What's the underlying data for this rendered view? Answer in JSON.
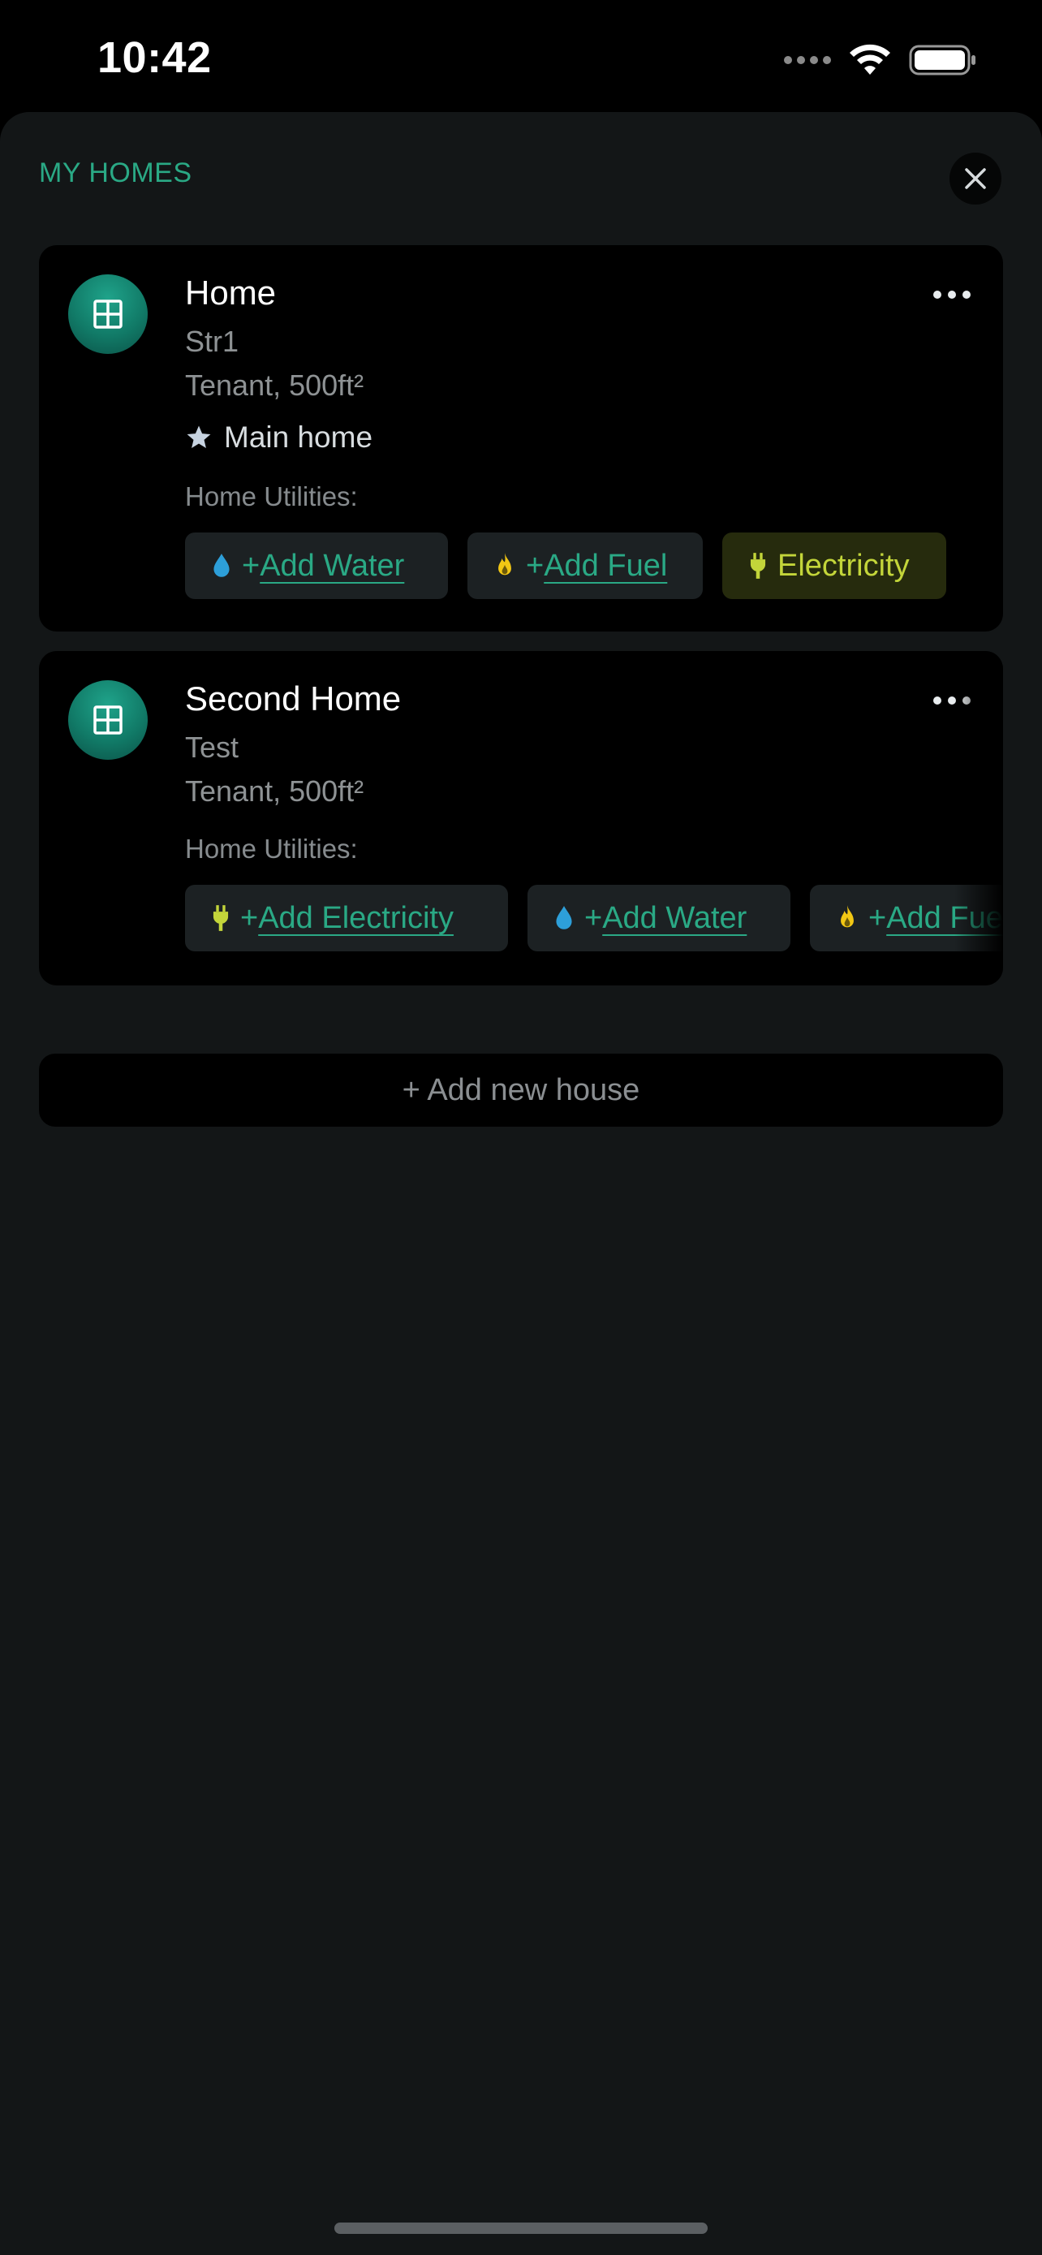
{
  "status": {
    "time": "10:42"
  },
  "sheet": {
    "title": "MY HOMES"
  },
  "homes": [
    {
      "name": "Home",
      "street": "Str1",
      "meta": "Tenant, 500ft²",
      "main_home_label": "Main home",
      "utilities_label": "Home Utilities:",
      "utilities": [
        {
          "icon": "water-drop-icon",
          "plus": "+",
          "label": "Add Water",
          "active": false
        },
        {
          "icon": "flame-icon",
          "plus": "+",
          "label": "Add Fuel",
          "active": false
        },
        {
          "icon": "plug-icon",
          "plus": "",
          "label": "Electricity",
          "active": true
        }
      ]
    },
    {
      "name": "Second Home",
      "street": "Test",
      "meta": "Tenant, 500ft²",
      "utilities_label": "Home Utilities:",
      "utilities": [
        {
          "icon": "plug-icon",
          "plus": "+",
          "label": "Add Electricity",
          "active": false
        },
        {
          "icon": "water-drop-icon",
          "plus": "+",
          "label": "Add Water",
          "active": false
        },
        {
          "icon": "flame-icon",
          "plus": "+",
          "label": "Add Fuel",
          "active": false
        }
      ]
    }
  ],
  "add_house_label": "+ Add new house",
  "colors": {
    "accent": "#2aa985",
    "electricity": "#c3d53a",
    "water": "#2d9fd9",
    "fuel": "#f2c714"
  }
}
